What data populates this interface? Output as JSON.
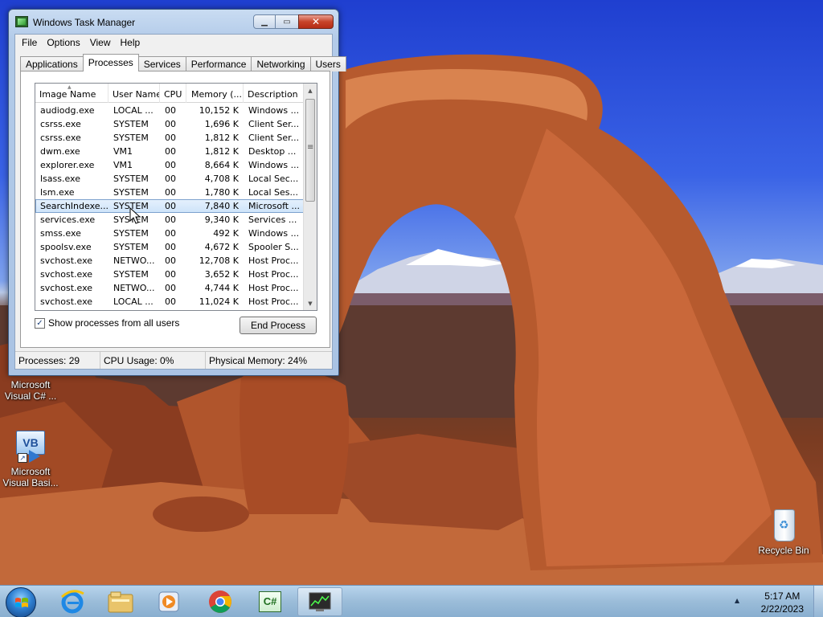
{
  "window": {
    "title": "Windows Task Manager",
    "minimize_icon": "minimize-icon",
    "maximize_icon": "maximize-icon",
    "close_icon": "close-icon"
  },
  "menu": [
    "File",
    "Options",
    "View",
    "Help"
  ],
  "tabs": [
    "Applications",
    "Processes",
    "Services",
    "Performance",
    "Networking",
    "Users"
  ],
  "active_tab": "Processes",
  "columns": [
    "Image Name",
    "User Name",
    "CPU",
    "Memory (...",
    "Description"
  ],
  "processes": [
    {
      "image": "audiodg.exe",
      "user": "LOCAL ...",
      "cpu": "00",
      "memory": "10,152 K",
      "description": "Windows ..."
    },
    {
      "image": "csrss.exe",
      "user": "SYSTEM",
      "cpu": "00",
      "memory": "1,696 K",
      "description": "Client Ser..."
    },
    {
      "image": "csrss.exe",
      "user": "SYSTEM",
      "cpu": "00",
      "memory": "1,812 K",
      "description": "Client Ser..."
    },
    {
      "image": "dwm.exe",
      "user": "VM1",
      "cpu": "00",
      "memory": "1,812 K",
      "description": "Desktop ..."
    },
    {
      "image": "explorer.exe",
      "user": "VM1",
      "cpu": "00",
      "memory": "8,664 K",
      "description": "Windows ..."
    },
    {
      "image": "lsass.exe",
      "user": "SYSTEM",
      "cpu": "00",
      "memory": "4,708 K",
      "description": "Local Sec..."
    },
    {
      "image": "lsm.exe",
      "user": "SYSTEM",
      "cpu": "00",
      "memory": "1,780 K",
      "description": "Local Ses..."
    },
    {
      "image": "SearchIndexe...",
      "user": "SYSTEM",
      "cpu": "00",
      "memory": "7,840 K",
      "description": "Microsoft ...",
      "selected": true
    },
    {
      "image": "services.exe",
      "user": "SYSTEM",
      "cpu": "00",
      "memory": "9,340 K",
      "description": "Services ..."
    },
    {
      "image": "smss.exe",
      "user": "SYSTEM",
      "cpu": "00",
      "memory": "492 K",
      "description": "Windows ..."
    },
    {
      "image": "spoolsv.exe",
      "user": "SYSTEM",
      "cpu": "00",
      "memory": "4,672 K",
      "description": "Spooler S..."
    },
    {
      "image": "svchost.exe",
      "user": "NETWO...",
      "cpu": "00",
      "memory": "12,708 K",
      "description": "Host Proc..."
    },
    {
      "image": "svchost.exe",
      "user": "SYSTEM",
      "cpu": "00",
      "memory": "3,652 K",
      "description": "Host Proc..."
    },
    {
      "image": "svchost.exe",
      "user": "NETWO...",
      "cpu": "00",
      "memory": "4,744 K",
      "description": "Host Proc..."
    },
    {
      "image": "svchost.exe",
      "user": "LOCAL ...",
      "cpu": "00",
      "memory": "11,024 K",
      "description": "Host Proc..."
    }
  ],
  "show_all_users": {
    "label": "Show processes from all users",
    "checked": true
  },
  "end_process_label": "End Process",
  "status": {
    "processes": "Processes: 29",
    "cpu": "CPU Usage: 0%",
    "memory": "Physical Memory: 24%"
  },
  "desktop_icons": [
    {
      "label": "Microsoft Visual C# ...",
      "icon": "visual-csharp-icon"
    },
    {
      "label": "Microsoft Visual Basi...",
      "icon": "visual-basic-icon"
    },
    {
      "label": "Recycle Bin",
      "icon": "recycle-bin-icon"
    }
  ],
  "vb_badge": "VB",
  "cs_badge": "C#",
  "taskbar": {
    "items": [
      "internet-explorer-icon",
      "file-explorer-icon",
      "media-player-icon",
      "chrome-icon",
      "visual-csharp-icon",
      "task-manager-icon"
    ],
    "active": "task-manager-icon"
  },
  "clock": {
    "time": "5:17 AM",
    "date": "2/22/2023"
  },
  "colors": {
    "selection": "#cde3f9",
    "close_button": "#c7432a",
    "sky": "#2a52de"
  }
}
